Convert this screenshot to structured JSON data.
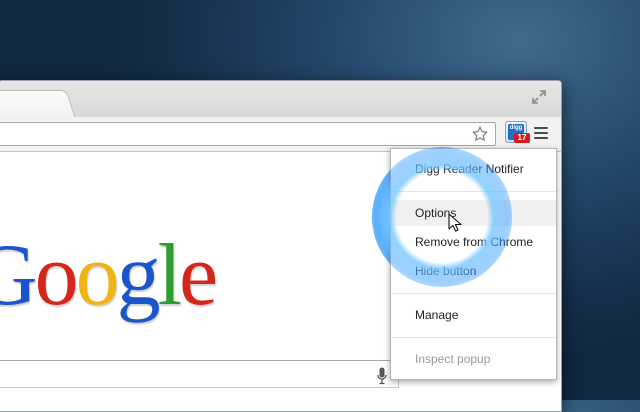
{
  "browser": {
    "toolbar": {
      "extension_name": "digg",
      "extension_badge": "17"
    }
  },
  "page": {
    "logo_letters": [
      "G",
      "o",
      "o",
      "g",
      "l",
      "e"
    ],
    "logo_colors": [
      "#1a56c9",
      "#d4261c",
      "#f0b414",
      "#1a56c9",
      "#2f9d2f",
      "#d4261c"
    ]
  },
  "context_menu": {
    "items": [
      {
        "label": "Digg Reader Notifier",
        "state": "normal"
      },
      {
        "label": "Options",
        "state": "hovered"
      },
      {
        "label": "Remove from Chrome",
        "state": "normal"
      },
      {
        "label": "Hide button",
        "state": "normal"
      },
      {
        "label": "Manage",
        "state": "normal"
      },
      {
        "label": "Inspect popup",
        "state": "disabled"
      }
    ]
  },
  "colors": {
    "accent_glow": "#3aa0ff",
    "badge": "#d31b1b",
    "extension_icon": "#1d6fc6"
  },
  "icons": [
    "fullscreen-icon",
    "star-icon",
    "digg-extension-icon",
    "chrome-menu-icon",
    "microphone-icon",
    "mouse-cursor-icon"
  ]
}
